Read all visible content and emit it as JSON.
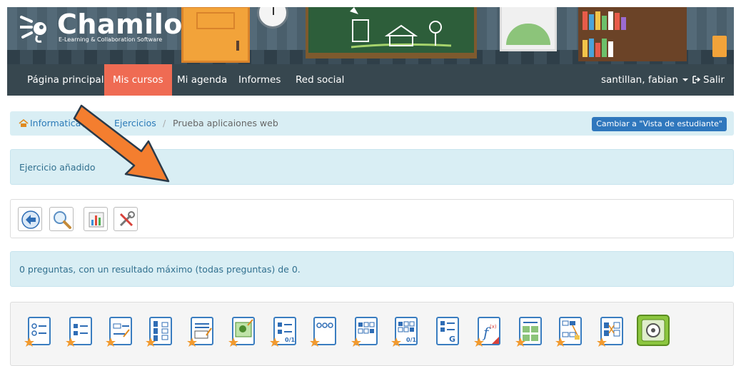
{
  "brand": {
    "name": "Chamilo",
    "tagline": "E-Learning & Collaboration Software"
  },
  "navbar": {
    "items": [
      {
        "label": "Página principal"
      },
      {
        "label": "Mis cursos"
      },
      {
        "label": "Mi agenda"
      },
      {
        "label": "Informes"
      },
      {
        "label": "Red social"
      }
    ],
    "active_item": "Mis cursos",
    "user_label": "santillan, fabian",
    "logout_label": "Salir"
  },
  "breadcrumb": {
    "course": "Informatica",
    "section": "Ejercicios",
    "current": "Prueba aplicaiones web",
    "separator": "/",
    "student_view_button": "Cambiar a \"Vista de estudiante\""
  },
  "alerts": {
    "added": "Ejercicio añadido",
    "summary": "0 preguntas, con un resultado máximo (todas preguntas) de 0."
  },
  "toolbar": {
    "icons": [
      "back-icon",
      "preview-icon",
      "results-icon",
      "settings-icon"
    ]
  },
  "question_types": {
    "icons": [
      "unique-answer-icon",
      "multiple-answer-icon",
      "fill-blanks-icon",
      "matching-icon",
      "open-question-icon",
      "hotspot-icon",
      "combination-icon",
      "unique-no-option-icon",
      "multiple-true-false-icon",
      "combination-true-false-icon",
      "global-multiple-icon",
      "calculated-answer-icon",
      "image-zones-icon",
      "drag-and-drop-icon",
      "matching-draggable-icon",
      "question-bank-icon"
    ]
  },
  "colors": {
    "navbar_bg": "#37474f",
    "active_tab": "#ef6b53",
    "info_bg": "#d9eef4",
    "link": "#2a7ab8",
    "button": "#2f77bd",
    "arrow": "#f47e2f"
  }
}
